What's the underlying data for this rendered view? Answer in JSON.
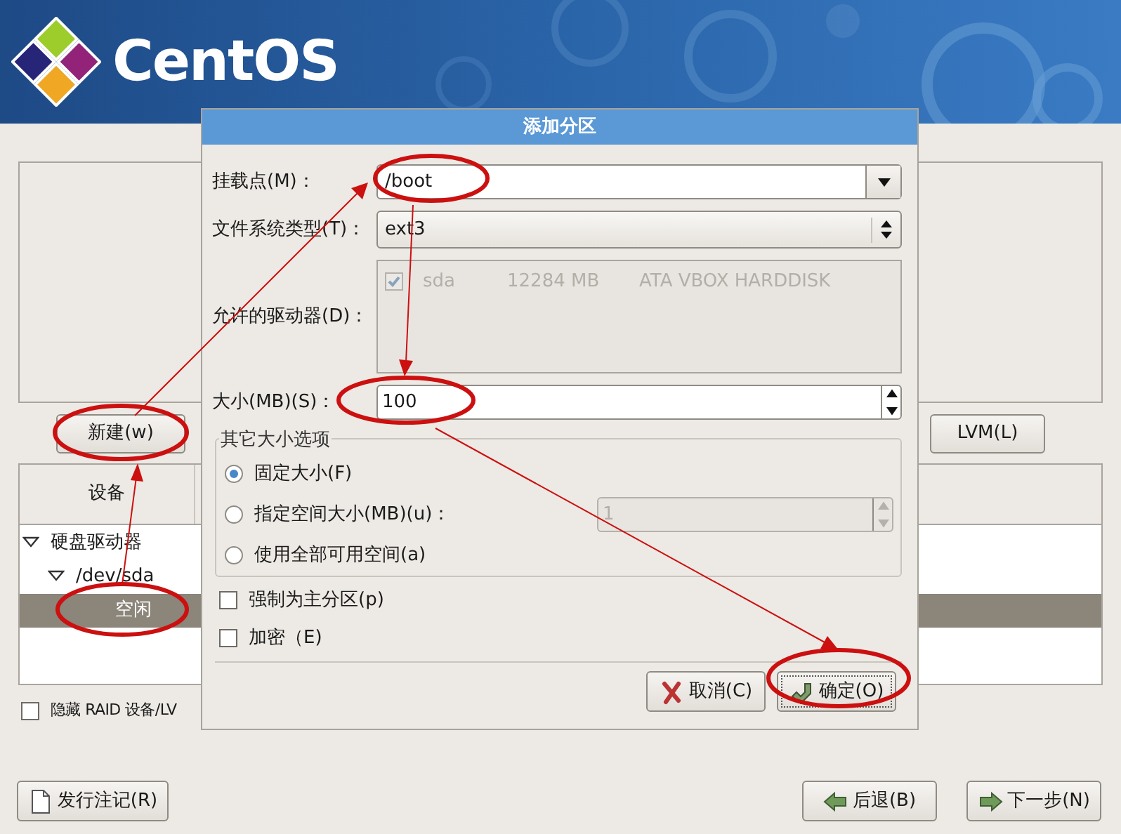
{
  "header": {
    "logo_text": "CentOS"
  },
  "partition_panel": {
    "buttons": [
      {
        "label": "新建(w)"
      },
      {
        "label": "LVM(L)"
      }
    ]
  },
  "device_table": {
    "columns": [
      "设备"
    ],
    "rows": [
      {
        "label": "硬盘驱动器",
        "expanded": true,
        "selected": false,
        "children": [
          {
            "label": "/dev/sda",
            "expanded": true,
            "selected": false,
            "children": [
              {
                "label": "空闲",
                "selected": true
              }
            ]
          }
        ]
      }
    ]
  },
  "hide_raid": {
    "label": "隐藏 RAID 设备/LV",
    "checked": false
  },
  "bottom_buttons": [
    {
      "label": "发行注记(R)"
    },
    {
      "label": "后退(B)"
    },
    {
      "label": "下一步(N)"
    }
  ],
  "dialog": {
    "title": "添加分区",
    "mount_point": {
      "label": "挂载点(M)：",
      "value": "/boot"
    },
    "fs_type": {
      "label": "文件系统类型(T)：",
      "value": "ext3"
    },
    "drives": {
      "label": "允许的驱动器(D)：",
      "items": [
        {
          "name": "sda",
          "size": "12284 MB",
          "model": "ATA VBOX HARDDISK",
          "checked": true,
          "disabled": true
        }
      ]
    },
    "size": {
      "label": "大小(MB)(S)：",
      "value": "100"
    },
    "size_options": {
      "title": "其它大小选项",
      "options": [
        {
          "label": "固定大小(F)",
          "selected": true
        },
        {
          "label": "指定空间大小(MB)(u)：",
          "selected": false
        },
        {
          "label": "使用全部可用空间(a)",
          "selected": false
        }
      ],
      "max_size": {
        "value": "1",
        "disabled": true
      }
    },
    "checkboxes": [
      {
        "label": "强制为主分区(p)",
        "checked": false
      },
      {
        "label": "加密（E)",
        "checked": false
      }
    ],
    "buttons": [
      {
        "label": "取消(C)"
      },
      {
        "label": "确定(O)"
      }
    ]
  }
}
